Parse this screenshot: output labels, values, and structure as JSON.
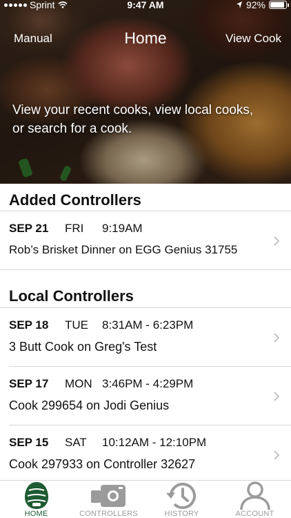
{
  "status_bar": {
    "carrier": "Sprint",
    "time": "9:47 AM",
    "battery": "92%",
    "battery_level": 0.92
  },
  "nav": {
    "left_label": "Manual",
    "title": "Home",
    "right_label": "View Cook"
  },
  "hero": {
    "text": "View your recent cooks, view local cooks, or search for a cook."
  },
  "sections": [
    {
      "title": "Added Controllers",
      "rows": [
        {
          "date": "SEP 21",
          "day": "FRI",
          "time": "9:19AM",
          "title": "Rob’s Brisket Dinner on EGG Genius 31755"
        }
      ]
    },
    {
      "title": "Local Controllers",
      "rows": [
        {
          "date": "SEP 18",
          "day": "TUE",
          "time": "8:31AM - 6:23PM",
          "title": "3 Butt Cook on Greg's Test"
        },
        {
          "date": "SEP 17",
          "day": "MON",
          "time": "3:46PM - 4:29PM",
          "title": "Cook 299654 on Jodi Genius"
        },
        {
          "date": "SEP 15",
          "day": "SAT",
          "time": "10:12AM - 12:10PM",
          "title": "Cook 297933 on Controller 32627"
        }
      ]
    }
  ],
  "tabs": [
    {
      "label": "HOME",
      "icon": "egg-icon",
      "active": true
    },
    {
      "label": "CONTROLLERS",
      "icon": "controller-icon",
      "active": false
    },
    {
      "label": "HISTORY",
      "icon": "history-icon",
      "active": false
    },
    {
      "label": "ACCOUNT",
      "icon": "account-icon",
      "active": false
    }
  ],
  "colors": {
    "active_tab": "#1e5b33",
    "inactive_tab": "#9b9b9b",
    "divider": "#d9d9d9"
  }
}
